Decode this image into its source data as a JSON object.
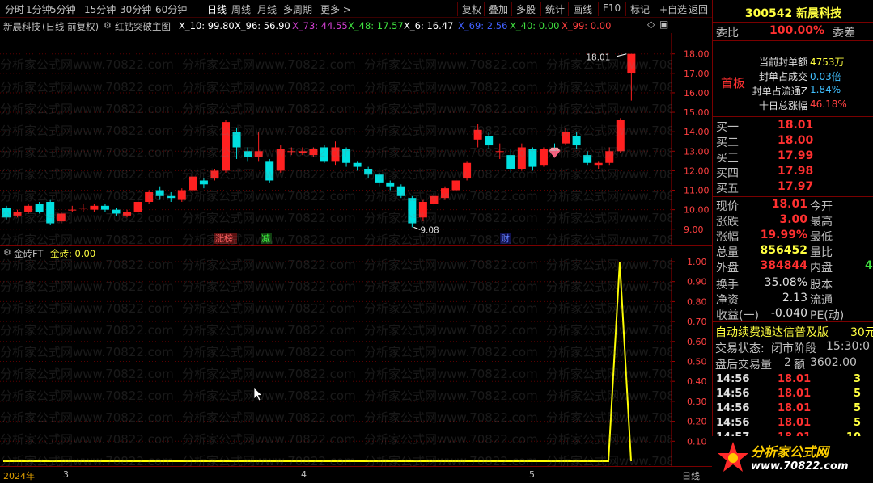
{
  "toolbar": {
    "timeframes": [
      "分时",
      "1分钟",
      "5分钟",
      "15分钟",
      "30分钟",
      "60分钟",
      "日线",
      "周线",
      "月线",
      "多周期",
      "更多 >"
    ],
    "active_timeframe": "日线",
    "buttons": [
      "复权",
      "叠加",
      "多股",
      "统计",
      "画线",
      "F10",
      "标记",
      "+自选",
      "返回"
    ]
  },
  "chart_header": {
    "stock": "新晨科技",
    "mode": "(日线 前复权)",
    "indicator": "红钻突破主图",
    "ma": [
      {
        "label": "X_10: 99.80",
        "color": "#ffffff"
      },
      {
        "label": "X_96: 56.90",
        "color": "#ffffff"
      },
      {
        "label": "X_73: 44.55",
        "color": "#d040d0"
      },
      {
        "label": "X_48: 17.57",
        "color": "#40e040"
      },
      {
        "label": "X_6: 16.47",
        "color": "#ffffff"
      },
      {
        "label": "X_69: 2.56",
        "color": "#4060ff"
      },
      {
        "label": "X_40: 0.00",
        "color": "#40e040"
      },
      {
        "label": "X_99: 0.00",
        "color": "#ff4040"
      }
    ]
  },
  "main_chart": {
    "y_ticks": [
      "18.00",
      "17.00",
      "16.00",
      "15.00",
      "14.00",
      "13.00",
      "12.00",
      "11.00",
      "10.00",
      "9.00"
    ],
    "ymin": 8.7,
    "ymax": 18.9,
    "candles": [
      [
        10.1,
        9.6,
        10.2,
        9.5
      ],
      [
        9.7,
        9.9,
        10.0,
        9.6
      ],
      [
        9.9,
        10.2,
        10.3,
        9.8
      ],
      [
        10.3,
        9.9,
        10.4,
        9.8
      ],
      [
        10.4,
        9.3,
        10.5,
        9.2
      ],
      [
        9.4,
        9.8,
        9.9,
        9.3
      ],
      [
        10.0,
        10.0,
        10.2,
        9.9
      ],
      [
        10.1,
        10.1,
        10.3,
        9.9
      ],
      [
        10.0,
        10.2,
        10.3,
        9.9
      ],
      [
        10.2,
        10.0,
        10.3,
        9.9
      ],
      [
        10.0,
        9.8,
        10.1,
        9.7
      ],
      [
        9.7,
        9.9,
        10.0,
        9.6
      ],
      [
        9.9,
        10.4,
        10.5,
        9.8
      ],
      [
        10.4,
        10.9,
        11.0,
        10.3
      ],
      [
        11.0,
        10.7,
        11.2,
        10.5
      ],
      [
        10.7,
        10.6,
        10.9,
        10.4
      ],
      [
        10.5,
        11.0,
        11.1,
        10.4
      ],
      [
        11.0,
        11.7,
        11.8,
        10.9
      ],
      [
        11.5,
        11.3,
        11.6,
        11.1
      ],
      [
        11.6,
        12.0,
        12.1,
        11.5
      ],
      [
        12.0,
        14.5,
        14.6,
        11.9
      ],
      [
        14.0,
        13.2,
        14.2,
        12.6
      ],
      [
        13.0,
        12.7,
        13.2,
        12.5
      ],
      [
        12.7,
        13.0,
        14.0,
        12.5
      ],
      [
        12.5,
        11.5,
        12.6,
        11.4
      ],
      [
        12.0,
        13.1,
        13.3,
        11.9
      ],
      [
        13.0,
        13.0,
        13.2,
        12.8
      ],
      [
        12.9,
        13.0,
        13.2,
        12.8
      ],
      [
        12.8,
        13.1,
        13.2,
        12.7
      ],
      [
        13.2,
        12.5,
        13.3,
        12.4
      ],
      [
        12.5,
        13.2,
        13.5,
        12.3
      ],
      [
        13.1,
        12.4,
        13.2,
        12.2
      ],
      [
        12.4,
        12.2,
        12.5,
        12.0
      ],
      [
        12.1,
        11.8,
        12.2,
        11.6
      ],
      [
        11.8,
        11.4,
        11.9,
        11.2
      ],
      [
        11.4,
        11.2,
        11.5,
        11.0
      ],
      [
        11.2,
        10.7,
        11.3,
        10.6
      ],
      [
        10.6,
        9.3,
        10.7,
        9.1
      ],
      [
        9.6,
        10.4,
        10.5,
        9.4
      ],
      [
        10.3,
        10.7,
        10.8,
        10.2
      ],
      [
        10.6,
        11.1,
        11.2,
        10.5
      ],
      [
        11.0,
        11.5,
        11.6,
        10.9
      ],
      [
        11.6,
        12.4,
        12.5,
        11.5
      ],
      [
        13.6,
        14.1,
        14.4,
        13.2
      ],
      [
        13.8,
        13.3,
        14.0,
        13.1
      ],
      [
        13.0,
        13.0,
        13.4,
        12.6
      ],
      [
        12.8,
        12.1,
        13.1,
        11.9
      ],
      [
        12.1,
        13.2,
        13.4,
        12.0
      ],
      [
        13.1,
        12.2,
        13.2,
        12.0
      ],
      [
        12.3,
        13.1,
        13.2,
        12.2
      ],
      [
        13.1,
        13.0,
        13.4,
        12.9
      ],
      [
        13.4,
        14.0,
        14.2,
        13.3
      ],
      [
        13.8,
        13.3,
        14.0,
        13.1
      ],
      [
        12.8,
        12.4,
        13.0,
        12.3
      ],
      [
        12.3,
        12.4,
        12.5,
        12.1
      ],
      [
        12.4,
        13.0,
        13.2,
        12.3
      ],
      [
        13.0,
        14.6,
        14.7,
        12.9
      ],
      [
        17.0,
        18.0,
        18.0,
        15.6
      ]
    ],
    "high_label": "18.01",
    "low_label": "9.08",
    "tags": [
      "涨榜",
      "减",
      "财"
    ]
  },
  "indicator": {
    "name": "金砖FT",
    "value_label": "金砖: 0.00",
    "y_ticks": [
      "1.00",
      "0.90",
      "0.80",
      "0.70",
      "0.60",
      "0.50",
      "0.40",
      "0.30",
      "0.20",
      "0.10"
    ]
  },
  "x_axis": {
    "labels": [
      "2024年",
      "3",
      "4",
      "5"
    ],
    "right_label": "日线"
  },
  "watermark": "分析家公式网www.70822.com",
  "quote": {
    "code": "300542",
    "name": "新晨科技",
    "weibi_label": "委比",
    "weibi_value": "100.00%",
    "weicha_label": "委差",
    "seal": [
      {
        "label": "当前封单额",
        "value": "4753万"
      },
      {
        "label": "封单占成交",
        "value": "0.03倍"
      },
      {
        "label": "封单占流通Z",
        "value": "1.84%"
      },
      {
        "label": "十日总涨幅",
        "value": "46.18%"
      }
    ],
    "first_board": "首板",
    "bids": [
      {
        "label": "买一",
        "price": "18.01"
      },
      {
        "label": "买二",
        "price": "18.00"
      },
      {
        "label": "买三",
        "price": "17.99"
      },
      {
        "label": "买四",
        "price": "17.98"
      },
      {
        "label": "买五",
        "price": "17.97"
      }
    ],
    "stats": [
      {
        "l": "现价",
        "v": "18.01",
        "r": "今开"
      },
      {
        "l": "涨跌",
        "v": "3.00",
        "r": "最高"
      },
      {
        "l": "涨幅",
        "v": "19.99%",
        "r": "最低"
      },
      {
        "l": "总量",
        "v": "856452",
        "r": "量比"
      },
      {
        "l": "外盘",
        "v": "384844",
        "r": "内盘",
        "rv": "4"
      }
    ],
    "stats2": [
      {
        "l": "换手",
        "v": "35.08%",
        "r": "股本"
      },
      {
        "l": "净资",
        "v": "2.13",
        "r": "流通"
      },
      {
        "l": "收益(一)",
        "v": "-0.040",
        "r": "PE(动)"
      }
    ],
    "promo": "自动续费通达信普及版",
    "promo_price": "30元",
    "trade_state_label": "交易状态:",
    "trade_state": "闭市阶段",
    "trade_time": "15:30:0",
    "after_label": "盘后交易量",
    "after_vol": "2",
    "after_amt_label": "额",
    "after_amt": "3602.00",
    "ticks": [
      {
        "t": "14:56",
        "p": "18.01",
        "v": "3"
      },
      {
        "t": "14:56",
        "p": "18.01",
        "v": "5"
      },
      {
        "t": "14:56",
        "p": "18.01",
        "v": "5"
      },
      {
        "t": "14:56",
        "p": "18.01",
        "v": "5"
      },
      {
        "t": "14:57",
        "p": "18.01",
        "v": "10"
      }
    ],
    "logo_text": "分析家公式网",
    "logo_url": "www.70822.com"
  }
}
